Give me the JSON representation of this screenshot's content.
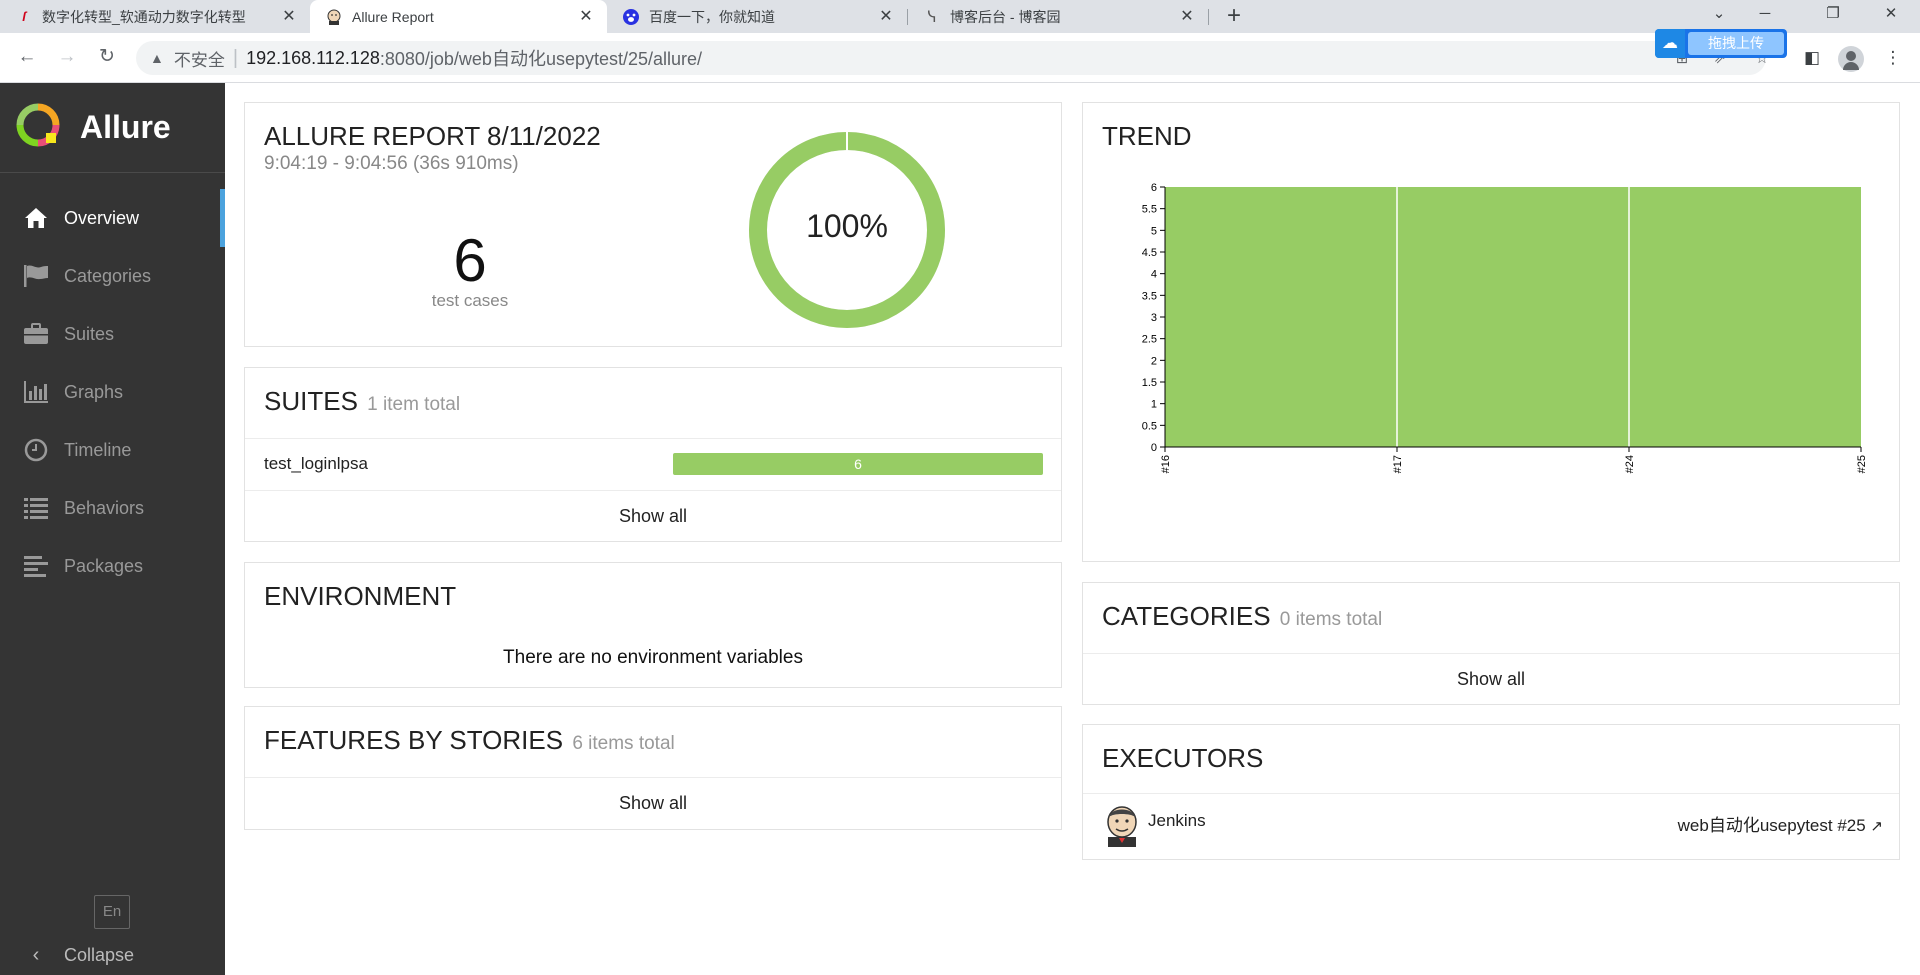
{
  "browser": {
    "tabs": [
      {
        "title": "数字化转型_软通动力数字化转型",
        "favicon": "softstone-icon"
      },
      {
        "title": "Allure Report",
        "favicon": "jenkins-icon"
      },
      {
        "title": "百度一下，你就知道",
        "favicon": "baidu-icon"
      },
      {
        "title": "博客后台 - 博客园",
        "favicon": "cnblogs-icon"
      }
    ],
    "address": {
      "insecure_label": "不安全",
      "host": "192.168.112.128",
      "path": ":8080/job/web自动化usepytest/25/allure/"
    },
    "extension_label": "拖拽上传"
  },
  "sidebar": {
    "brand": "Allure",
    "items": [
      {
        "label": "Overview",
        "icon": "home-icon"
      },
      {
        "label": "Categories",
        "icon": "flag-icon"
      },
      {
        "label": "Suites",
        "icon": "briefcase-icon"
      },
      {
        "label": "Graphs",
        "icon": "bar-chart-icon"
      },
      {
        "label": "Timeline",
        "icon": "clock-icon"
      },
      {
        "label": "Behaviors",
        "icon": "list-icon"
      },
      {
        "label": "Packages",
        "icon": "align-left-icon"
      }
    ],
    "language": "En",
    "collapse": "Collapse"
  },
  "summary": {
    "title": "ALLURE REPORT 8/11/2022",
    "time_range": "9:04:19 - 9:04:56 (36s 910ms)",
    "test_count": "6",
    "test_count_label": "test cases",
    "pass_rate": "100%",
    "pass_fraction": 1.0
  },
  "suites": {
    "title": "SUITES",
    "total": "1 item total",
    "items": [
      {
        "name": "test_loginlpsa",
        "count": "6"
      }
    ],
    "show_all": "Show all"
  },
  "environment": {
    "title": "ENVIRONMENT",
    "empty": "There are no environment variables"
  },
  "features": {
    "title": "FEATURES BY STORIES",
    "total": "6 items total",
    "show_all": "Show all"
  },
  "trend": {
    "title": "TREND"
  },
  "chart_data": {
    "type": "area",
    "x": [
      "#16",
      "#17",
      "#24",
      "#25"
    ],
    "series": [
      {
        "values": [
          6,
          6,
          6,
          6
        ],
        "color": "#97cc64"
      }
    ],
    "ylim": [
      0,
      6
    ],
    "yticks": [
      "0",
      "0.5",
      "1",
      "1.5",
      "2",
      "2.5",
      "3",
      "3.5",
      "4",
      "4.5",
      "5",
      "5.5",
      "6"
    ],
    "title": "",
    "xlabel": "",
    "ylabel": ""
  },
  "categories": {
    "title": "CATEGORIES",
    "total": "0 items total",
    "show_all": "Show all"
  },
  "executors": {
    "title": "EXECUTORS",
    "name": "Jenkins",
    "build": "web自动化usepytest #25",
    "avatar": "jenkins-avatar"
  },
  "colors": {
    "passed": "#97cc64",
    "sidebar": "#343434",
    "accent": "#4ba2dd"
  }
}
